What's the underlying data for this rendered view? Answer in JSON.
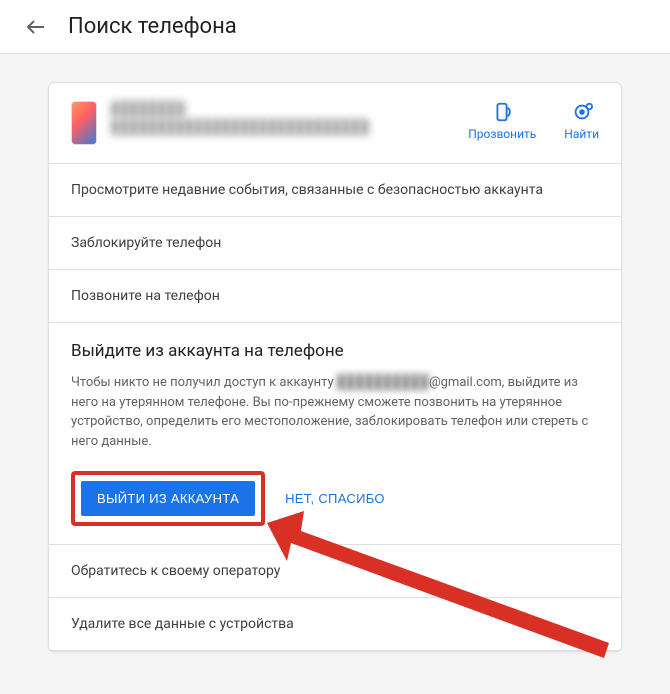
{
  "header": {
    "title": "Поиск телефона"
  },
  "device": {
    "name_blurred": "████████",
    "details_blurred": "████████████████████████████",
    "actions": {
      "ring": "Прозвонить",
      "find": "Найти"
    }
  },
  "options": {
    "security_events": "Просмотрите недавние события, связанные с безопасностью аккаунта",
    "lock_phone": "Заблокируйте телефон",
    "call_phone": "Позвоните на телефон",
    "contact_carrier": "Обратитесь к своему оператору",
    "erase_device": "Удалите все данные с устройства"
  },
  "signout": {
    "title": "Выйдите из аккаунта на телефоне",
    "desc_prefix": "Чтобы никто не получил доступ к аккаунту ",
    "email_blurred": "██████████",
    "email_domain": "@gmail.com",
    "desc_suffix": ", выйдите из него на утерянном телефоне. Вы по-прежнему сможете позвонить на утерянное устройство, определить его местоположение, заблокировать телефон или стереть с него данные.",
    "primary_btn": "ВЫЙТИ ИЗ АККАУНТА",
    "secondary_btn": "НЕТ, СПАСИБО"
  }
}
